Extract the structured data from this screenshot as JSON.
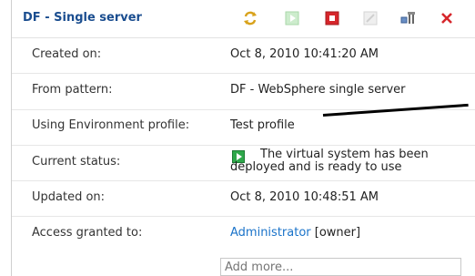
{
  "header": {
    "title": "DF - Single server"
  },
  "toolbar": {
    "icons": [
      "refresh-icon",
      "start-icon",
      "stop-icon",
      "edit-icon",
      "clone-icon",
      "delete-icon"
    ]
  },
  "rows": {
    "created": {
      "label": "Created on:",
      "value": "Oct 8, 2010 10:41:20 AM"
    },
    "pattern": {
      "label": "From pattern:",
      "value": "DF - WebSphere single server"
    },
    "profile": {
      "label": "Using Environment profile:",
      "value": "Test profile"
    },
    "status": {
      "label": "Current status:",
      "value": "The virtual system has been deployed and is ready to use"
    },
    "updated": {
      "label": "Updated on:",
      "value": "Oct 8, 2010 10:48:51 AM"
    },
    "access": {
      "label": "Access granted to:",
      "value_link": "Administrator",
      "value_suffix": " [owner]"
    }
  },
  "access_input": {
    "placeholder": "Add more..."
  },
  "colors": {
    "title": "#1a4d8f",
    "link": "#1a73c9",
    "stop": "#d6262b",
    "delete": "#d6262b",
    "status_ok": "#2ea84a"
  }
}
